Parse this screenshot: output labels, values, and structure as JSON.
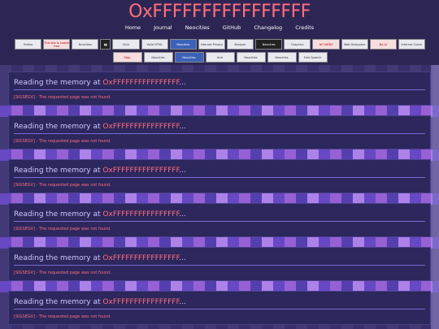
{
  "site": {
    "title": "OxFFFFFFFFFFFFFFFF"
  },
  "nav": [
    "Home",
    "Journal",
    "Neocities",
    "GitHub",
    "Changelog",
    "Credits"
  ],
  "badges": {
    "row1": [
      "Firefox",
      "This site is cookie free",
      "Neocities",
      "pause",
      "Click",
      "Valid HTML",
      "Neocities",
      "Internet Privacy",
      "Browser",
      "Neocities",
      "Graphics",
      "AntiNFT",
      "NO WEB3",
      "Web Designers",
      "No AI",
      "Internet Check"
    ],
    "row2": [
      "Stop",
      "Neocities",
      "Neocities",
      "Anti",
      "Neocities",
      "Neocities",
      "Free Speech"
    ]
  },
  "posts": [
    {
      "title_prefix": "Reading the memory at ",
      "address": "OxFFFFFFFFFFFFFFFF",
      "title_suffix": "...",
      "message": "[SIGSEGV] - The requested page was not found."
    },
    {
      "title_prefix": "Reading the memory at ",
      "address": "OxFFFFFFFFFFFFFFFF",
      "title_suffix": "...",
      "message": "[SIGSEGV] - The requested page was not found."
    },
    {
      "title_prefix": "Reading the memory at ",
      "address": "OxFFFFFFFFFFFFFFFF",
      "title_suffix": "...",
      "message": "[SIGSEGV] - The requested page was not found."
    },
    {
      "title_prefix": "Reading the memory at ",
      "address": "OxFFFFFFFFFFFFFFFF",
      "title_suffix": "...",
      "message": "[SIGSEGV] - The requested page was not found."
    },
    {
      "title_prefix": "Reading the memory at ",
      "address": "OxFFFFFFFFFFFFFFFF",
      "title_suffix": "...",
      "message": "[SIGSEGV] - The requested page was not found."
    },
    {
      "title_prefix": "Reading the memory at ",
      "address": "OxFFFFFFFFFFFFFFFF",
      "title_suffix": "...",
      "message": "[SIGSEGV] - The requested page was not found."
    }
  ]
}
